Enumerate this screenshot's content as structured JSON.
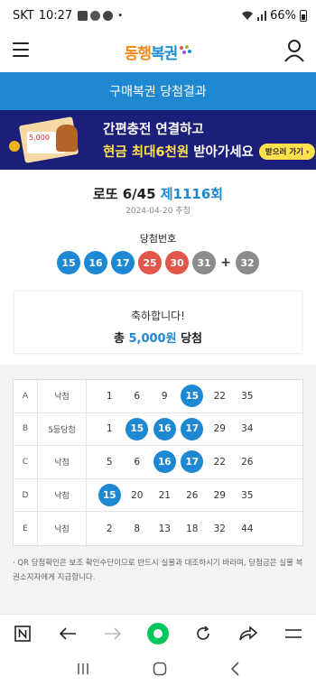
{
  "status_bar": {
    "carrier": "SKT",
    "time": "10:27",
    "battery": "66%"
  },
  "app": {
    "logo_text_a": "동행",
    "logo_text_b": "복권"
  },
  "title_band": "구매복권 당첨결과",
  "banner": {
    "line1": "간편충전 연결하고",
    "line2_highlight": "현금 최대6천원",
    "line2_rest": "받아가세요",
    "cta": "받으러 가기 ›",
    "ticket_text": "5,000"
  },
  "draw": {
    "game": "로또 6/45",
    "round": "제1116회",
    "date": "2024-04-20 추첨",
    "winning_label": "당첨번호",
    "numbers": [
      {
        "n": "15",
        "color": "#1e88d2"
      },
      {
        "n": "16",
        "color": "#1e88d2"
      },
      {
        "n": "17",
        "color": "#1e88d2"
      },
      {
        "n": "25",
        "color": "#e3574b"
      },
      {
        "n": "30",
        "color": "#e3574b"
      },
      {
        "n": "31",
        "color": "#8c8c8c"
      }
    ],
    "plus": "+",
    "bonus": {
      "n": "32",
      "color": "#8c8c8c"
    }
  },
  "result": {
    "message": "축하합니다!",
    "prefix": "총",
    "amount": "5,000원",
    "suffix": "당첨"
  },
  "tickets": [
    {
      "label": "A",
      "result": "낙첨",
      "numbers": [
        "1",
        "6",
        "9",
        "15",
        "22",
        "35"
      ],
      "hits": [
        false,
        false,
        false,
        true,
        false,
        false
      ]
    },
    {
      "label": "B",
      "result": "5등당첨",
      "numbers": [
        "1",
        "15",
        "16",
        "17",
        "29",
        "34"
      ],
      "hits": [
        false,
        true,
        true,
        true,
        false,
        false
      ]
    },
    {
      "label": "C",
      "result": "낙첨",
      "numbers": [
        "5",
        "6",
        "16",
        "17",
        "22",
        "26"
      ],
      "hits": [
        false,
        false,
        true,
        true,
        false,
        false
      ]
    },
    {
      "label": "D",
      "result": "낙첨",
      "numbers": [
        "15",
        "20",
        "21",
        "26",
        "29",
        "35"
      ],
      "hits": [
        true,
        false,
        false,
        false,
        false,
        false
      ]
    },
    {
      "label": "E",
      "result": "낙첨",
      "numbers": [
        "2",
        "8",
        "13",
        "18",
        "32",
        "44"
      ],
      "hits": [
        false,
        false,
        false,
        false,
        false,
        false
      ]
    }
  ],
  "notice": "· QR 당첨확인은 보조 확인수단이므로 반드시 실물과 대조하시기 바라며, 당첨금은 실물 복권소지자에게 지급합니다.",
  "toolbar_icons": [
    "naver-n-icon",
    "back-arrow-icon",
    "forward-arrow-icon",
    "home-green-icon",
    "reload-icon",
    "share-icon",
    "menu-icon"
  ],
  "colors": {
    "accent": "#1e88d2",
    "banner_bg": "#1c1f7a",
    "highlight": "#ffe14d"
  }
}
